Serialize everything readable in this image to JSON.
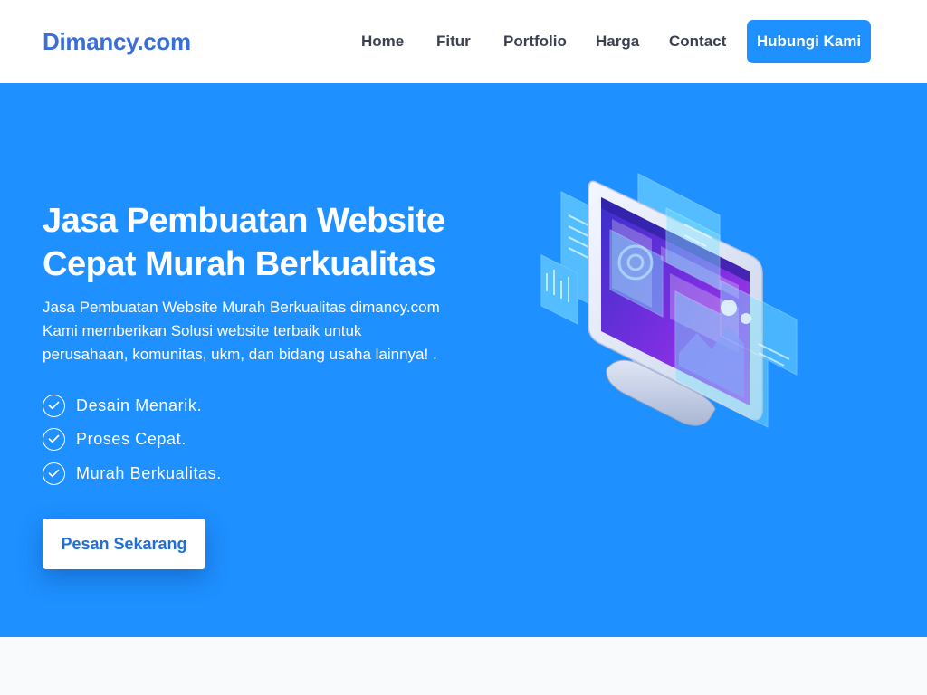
{
  "navbar": {
    "brand": "Dimancy.com",
    "links": [
      {
        "label": "Home"
      },
      {
        "label": "Fitur"
      },
      {
        "label": "Portfolio"
      },
      {
        "label": "Harga"
      },
      {
        "label": "Contact"
      }
    ],
    "cta_label": "Hubungi Kami"
  },
  "hero": {
    "title_lines": [
      "Jasa Pembuatan Website",
      "Cepat Murah Berkualitas"
    ],
    "description_lines": [
      "Jasa Pembuatan Website Murah Berkualitas dimancy.com",
      "Kami memberikan Solusi website terbaik untuk",
      "perusahaan, komunitas, ukm, dan bidang usaha lainnya! ."
    ],
    "features": [
      {
        "label": "Desain Menarik.",
        "icon": "check-circle-icon"
      },
      {
        "label": "Proses Cepat.",
        "icon": "check-circle-icon"
      },
      {
        "label": "Murah Berkualitas.",
        "icon": "check-circle-icon"
      }
    ],
    "button_label": "Pesan Sekarang",
    "illustration_icon": "computer-monitor-illustration"
  },
  "colors": {
    "primary": "#1e90ff",
    "brand_text": "#3a6fd8",
    "nav_text": "#3b4150",
    "lower_section": "#f8fafc"
  }
}
